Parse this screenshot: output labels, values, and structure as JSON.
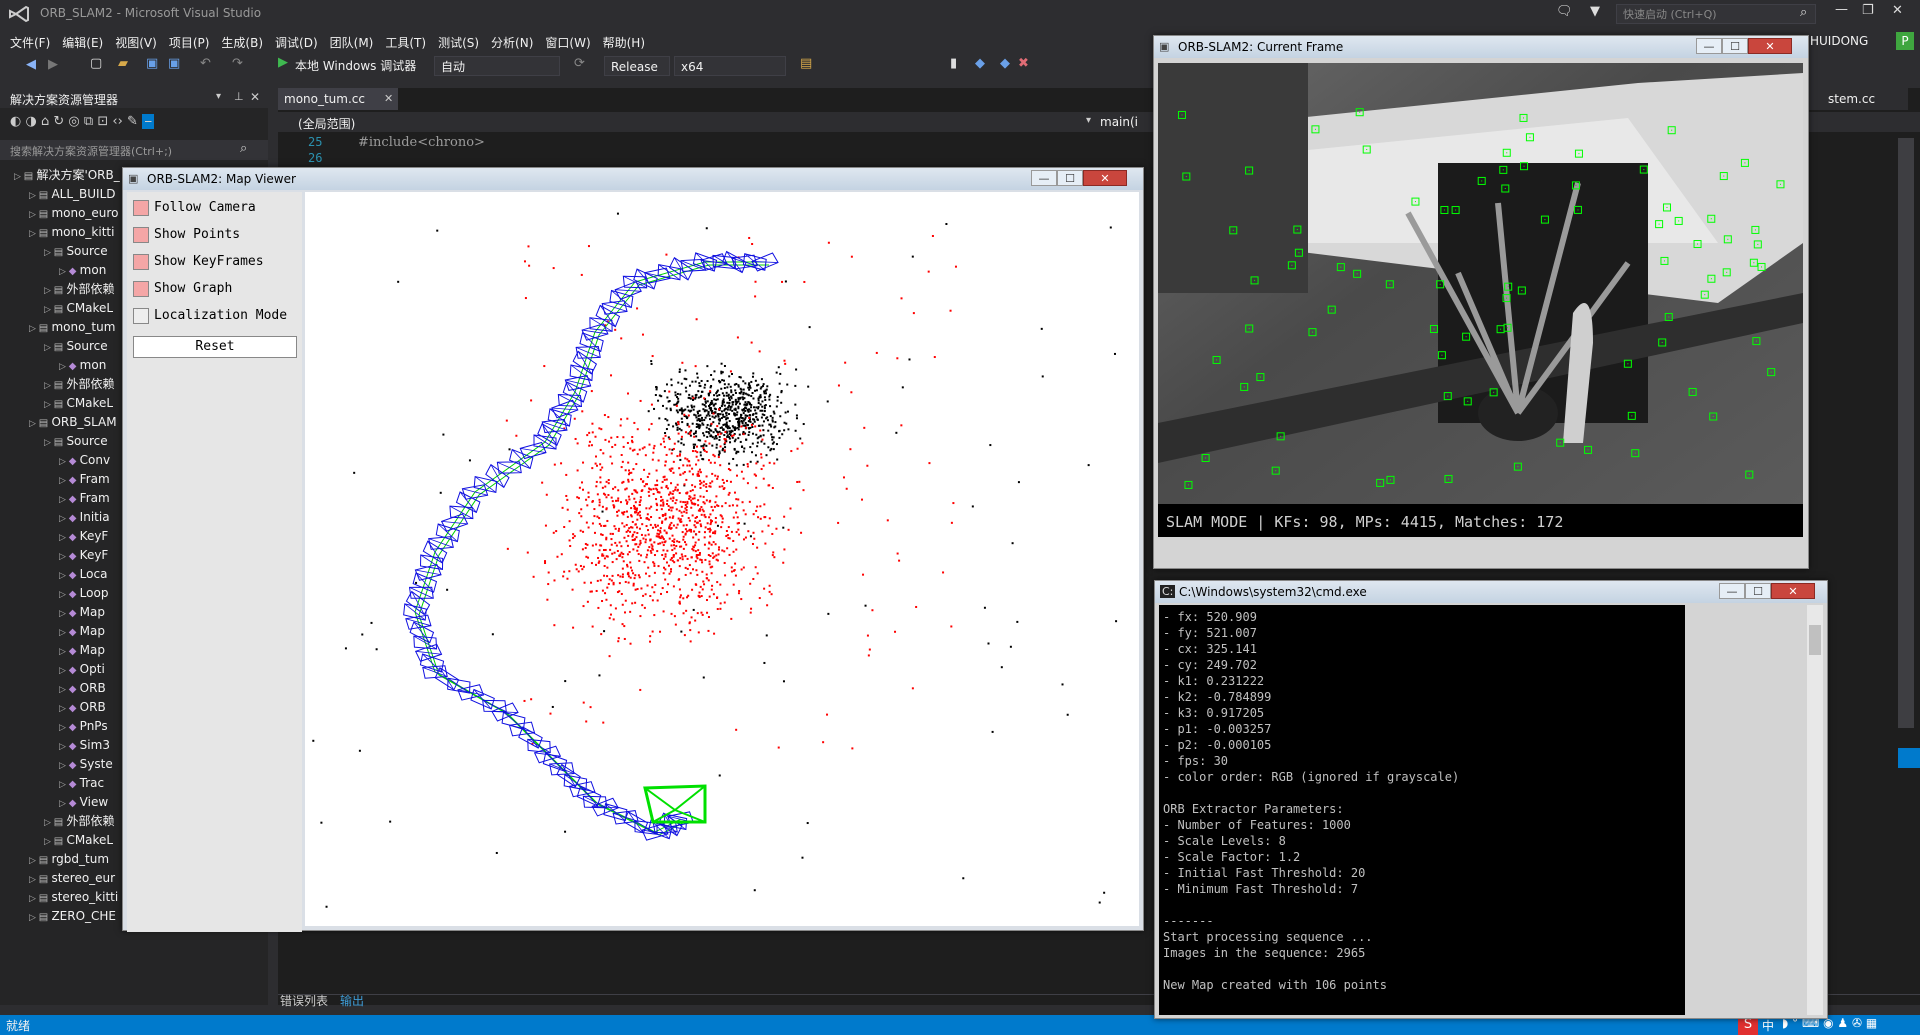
{
  "vs": {
    "window_title": "ORB_SLAM2 - Microsoft Visual Studio",
    "quick_launch": "快速启动 (Ctrl+Q)",
    "user": "HUIDONG",
    "user_badge": "P",
    "menus": [
      "文件(F)",
      "编辑(E)",
      "视图(V)",
      "项目(P)",
      "生成(B)",
      "调试(D)",
      "团队(M)",
      "工具(T)",
      "测试(S)",
      "分析(N)",
      "窗口(W)",
      "帮助(H)"
    ],
    "toolbar": {
      "run_label": "本地 Windows 调试器",
      "auto": "自动",
      "config": "Release",
      "platform": "x64"
    },
    "solution_explorer": {
      "title": "解决方案资源管理器",
      "search_placeholder": "搜索解决方案资源管理器(Ctrl+;)",
      "items": [
        {
          "label": "解决方案'ORB_",
          "indent": 0
        },
        {
          "label": "ALL_BUILD",
          "indent": 1
        },
        {
          "label": "mono_euro",
          "indent": 1
        },
        {
          "label": "mono_kitti",
          "indent": 1
        },
        {
          "label": "Source",
          "indent": 2
        },
        {
          "label": "mon",
          "indent": 3
        },
        {
          "label": "外部依赖",
          "indent": 2
        },
        {
          "label": "CMakeL",
          "indent": 2
        },
        {
          "label": "mono_tum",
          "indent": 1
        },
        {
          "label": "Source",
          "indent": 2
        },
        {
          "label": "mon",
          "indent": 3
        },
        {
          "label": "外部依赖",
          "indent": 2
        },
        {
          "label": "CMakeL",
          "indent": 2
        },
        {
          "label": "ORB_SLAM",
          "indent": 1
        },
        {
          "label": "Source",
          "indent": 2
        },
        {
          "label": "Conv",
          "indent": 3
        },
        {
          "label": "Fram",
          "indent": 3
        },
        {
          "label": "Fram",
          "indent": 3
        },
        {
          "label": "Initia",
          "indent": 3
        },
        {
          "label": "KeyF",
          "indent": 3
        },
        {
          "label": "KeyF",
          "indent": 3
        },
        {
          "label": "Loca",
          "indent": 3
        },
        {
          "label": "Loop",
          "indent": 3
        },
        {
          "label": "Map",
          "indent": 3
        },
        {
          "label": "Map",
          "indent": 3
        },
        {
          "label": "Map",
          "indent": 3
        },
        {
          "label": "Opti",
          "indent": 3
        },
        {
          "label": "ORB",
          "indent": 3
        },
        {
          "label": "ORB",
          "indent": 3
        },
        {
          "label": "PnPs",
          "indent": 3
        },
        {
          "label": "Sim3",
          "indent": 3
        },
        {
          "label": "Syste",
          "indent": 3
        },
        {
          "label": "Trac",
          "indent": 3
        },
        {
          "label": "View",
          "indent": 3
        },
        {
          "label": "外部依赖",
          "indent": 2
        },
        {
          "label": "CMakeL",
          "indent": 2
        },
        {
          "label": "rgbd_tum",
          "indent": 1
        },
        {
          "label": "stereo_eur",
          "indent": 1
        },
        {
          "label": "stereo_kitti",
          "indent": 1
        },
        {
          "label": "ZERO_CHE",
          "indent": 1
        }
      ]
    },
    "editor": {
      "tab": "mono_tum.cc",
      "tab_right": "stem.cc",
      "scope": "(全局范围)",
      "member": "main(i",
      "lines": [
        {
          "num": "25",
          "code": "#include<chrono>"
        },
        {
          "num": "26",
          "code": ""
        }
      ],
      "bottom_tabs": [
        "错误列表",
        "输出"
      ]
    },
    "status": "就绪",
    "ime": "中"
  },
  "map_viewer": {
    "title": "ORB-SLAM2: Map Viewer",
    "options": [
      {
        "label": "Follow Camera",
        "checked": true
      },
      {
        "label": "Show Points",
        "checked": true
      },
      {
        "label": "Show KeyFrames",
        "checked": true
      },
      {
        "label": "Show Graph",
        "checked": true
      },
      {
        "label": "Localization Mode",
        "checked": false
      }
    ],
    "reset": "Reset",
    "colors": {
      "keyframe": "#1010e0",
      "graph": "#00d000",
      "current": "#00e000",
      "point_ref": "#ff0000",
      "point": "#000000"
    }
  },
  "current_frame": {
    "title": "ORB-SLAM2: Current Frame",
    "status": "SLAM MODE |  KFs: 98, MPs: 4415, Matches: 172"
  },
  "cmd": {
    "title": "C:\\Windows\\system32\\cmd.exe",
    "lines": [
      "- fx: 520.909",
      "- fy: 521.007",
      "- cx: 325.141",
      "- cy: 249.702",
      "- k1: 0.231222",
      "- k2: -0.784899",
      "- k3: 0.917205",
      "- p1: -0.003257",
      "- p2: -0.000105",
      "- fps: 30",
      "- color order: RGB (ignored if grayscale)",
      "",
      "ORB Extractor Parameters:",
      "- Number of Features: 1000",
      "- Scale Levels: 8",
      "- Scale Factor: 1.2",
      "- Initial Fast Threshold: 20",
      "- Minimum Fast Threshold: 7",
      "",
      "-------",
      "Start processing sequence ...",
      "Images in the sequence: 2965",
      "",
      "New Map created with 106 points"
    ]
  }
}
